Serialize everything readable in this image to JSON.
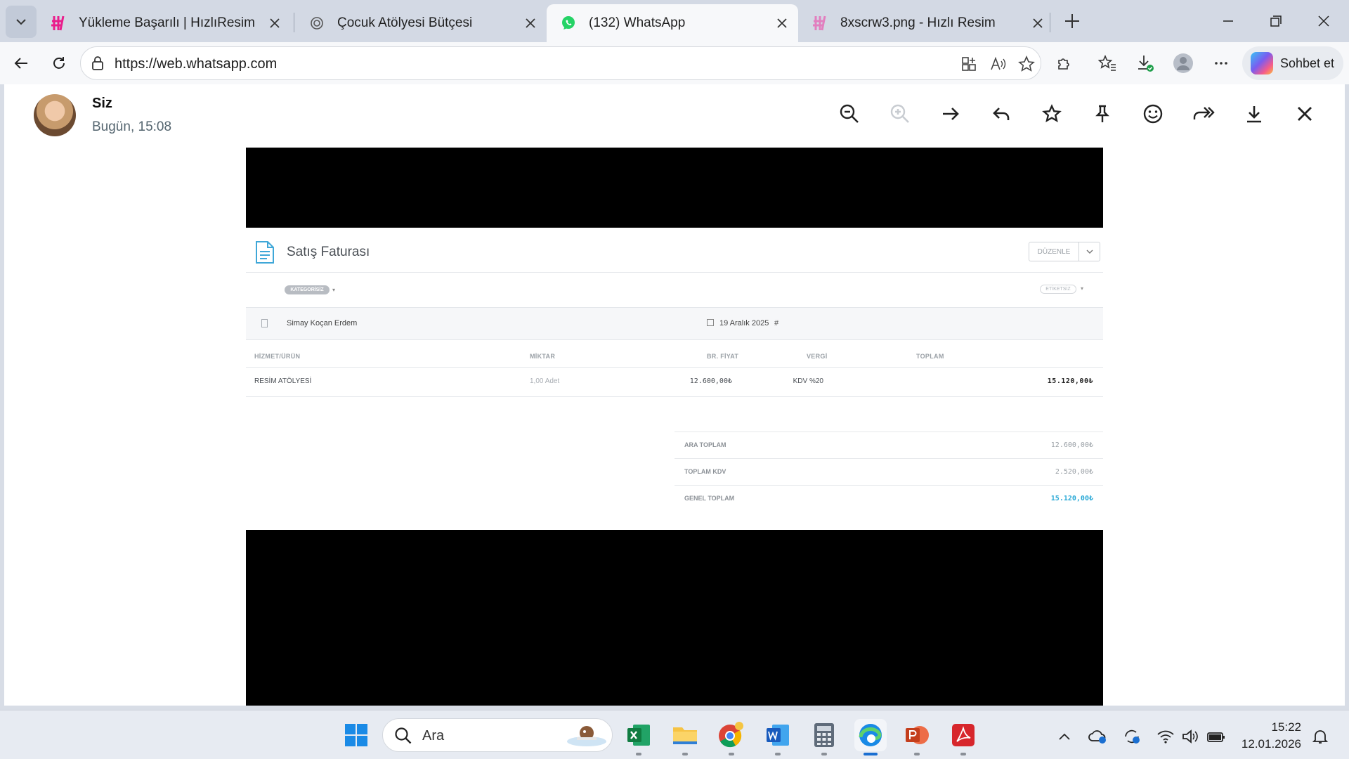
{
  "browser": {
    "tabs": [
      {
        "title": "Yükleme Başarılı | HızlıResim",
        "icon": "hizliresim-icon"
      },
      {
        "title": "Çocuk Atölyesi Bütçesi",
        "icon": "chatgpt-icon"
      },
      {
        "title": "(132) WhatsApp",
        "icon": "whatsapp-icon",
        "active": true
      },
      {
        "title": "8xscrw3.png - Hızlı Resim",
        "icon": "hizliresim-icon"
      }
    ],
    "address": "https://web.whatsapp.com",
    "copilot_label": "Sohbet et",
    "colors": {
      "whatsapp": "#25d366",
      "hizliresim": "#e91e8c",
      "accent": "#1b6fd1"
    }
  },
  "viewer": {
    "sender": "Siz",
    "time": "Bugün, 15:08"
  },
  "invoice": {
    "title": "Satış Faturası",
    "edit_label": "DÜZENLE",
    "category_label": "KATEGORİSİZ",
    "tag_label": "ETİKETSİZ",
    "customer": "Simay Koçan Erdem",
    "date": "19 Aralık 2025",
    "hash": "#",
    "columns": [
      "HİZMET/ÜRÜN",
      "MİKTAR",
      "BR. FİYAT",
      "VERGİ",
      "TOPLAM"
    ],
    "rows": [
      {
        "item": "RESİM ATÖLYESİ",
        "qty": "1,00 Adet",
        "price": "12.600,00₺",
        "tax": "KDV %20",
        "total": "15.120,00₺"
      }
    ],
    "summary": [
      {
        "label": "ARA TOPLAM",
        "value": "12.600,00₺"
      },
      {
        "label": "TOPLAM KDV",
        "value": "2.520,00₺"
      },
      {
        "label": "GENEL TOPLAM",
        "value": "15.120,00₺"
      }
    ],
    "total_color": "#27a8d6"
  },
  "taskbar": {
    "search_placeholder": "Ara",
    "time": "15:22",
    "date": "12.01.2026"
  }
}
